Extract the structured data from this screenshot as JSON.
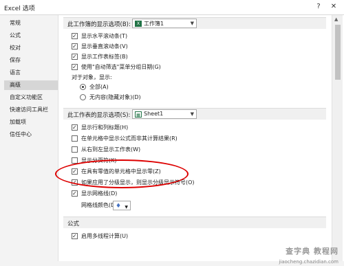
{
  "window": {
    "title": "Excel 选项",
    "help": "?",
    "close": "✕"
  },
  "sidebar": {
    "items": [
      {
        "label": "常规"
      },
      {
        "label": "公式"
      },
      {
        "label": "校对"
      },
      {
        "label": "保存"
      },
      {
        "label": "语言"
      },
      {
        "label": "高级",
        "active": true
      },
      {
        "label": "自定义功能区"
      },
      {
        "label": "快速访问工具栏"
      },
      {
        "label": "加载项"
      },
      {
        "label": "信任中心"
      }
    ]
  },
  "workbook_section": {
    "label": "此工作簿的显示选项(B):",
    "dropdown_value": "工作簿1",
    "options": [
      {
        "label": "显示水平滚动条(T)",
        "checked": true
      },
      {
        "label": "显示垂直滚动条(V)",
        "checked": true
      },
      {
        "label": "显示工作表标签(B)",
        "checked": true
      },
      {
        "label": "使用\"自动筛选\"菜单分组日期(G)",
        "checked": true
      }
    ],
    "objects_label": "对于对象，显示:",
    "radios": [
      {
        "label": "全部(A)",
        "selected": true
      },
      {
        "label": "无内容(隐藏对象)(D)",
        "selected": false
      }
    ]
  },
  "sheet_section": {
    "label": "此工作表的显示选项(S):",
    "dropdown_value": "Sheet1",
    "options": [
      {
        "label": "显示行和列标题(H)",
        "checked": true
      },
      {
        "label": "在单元格中显示公式而非其计算结果(R)",
        "checked": false
      },
      {
        "label": "从右到左显示工作表(W)",
        "checked": false
      },
      {
        "label": "显示分页符(K)",
        "checked": false
      },
      {
        "label": "在具有零值的单元格中显示零(Z)",
        "checked": true
      },
      {
        "label": "如果应用了分级显示，则显示分级显示符号(O)",
        "checked": true
      },
      {
        "label": "显示网格线(D)",
        "checked": true
      }
    ],
    "gridline_color_label": "网格线颜色(D)"
  },
  "formula_section": {
    "label": "公式",
    "options": [
      {
        "label": "启用多线程计算(U)",
        "checked": true
      }
    ]
  },
  "watermark": {
    "line1": "查字典 教程网",
    "line2": "jiaocheng.chazidian.com"
  },
  "colors": {
    "annotation": "#dd0000",
    "excel_green": "#217346"
  }
}
